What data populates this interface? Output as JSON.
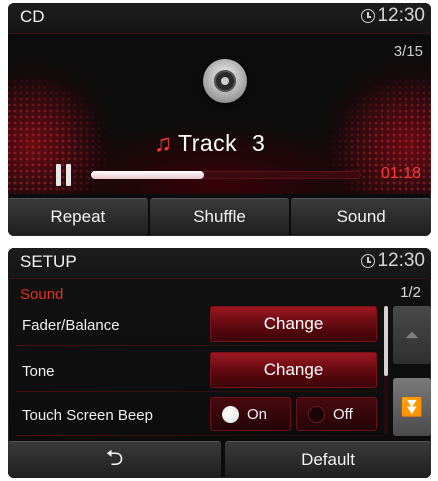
{
  "cd": {
    "title": "CD",
    "clock": "12:30",
    "track_count": "3/15",
    "track_title": "Track  3",
    "elapsed": "01:18",
    "progress": 0.42,
    "buttons": {
      "repeat": "Repeat",
      "shuffle": "Shuffle",
      "sound": "Sound"
    }
  },
  "setup": {
    "title": "SETUP",
    "clock": "12:30",
    "section": "Sound",
    "page": "1/2",
    "rows": [
      {
        "label": "Fader/Balance",
        "action": "Change"
      },
      {
        "label": "Tone",
        "action": "Change"
      },
      {
        "label": "Touch Screen Beep",
        "on": "On",
        "off": "Off",
        "selected": "On"
      }
    ],
    "buttons": {
      "default": "Default"
    }
  },
  "icons": [
    "clock-icon",
    "disc-icon",
    "music-note-icon",
    "pause-icon",
    "scroll-up-icon",
    "scroll-down-icon",
    "back-arrow-icon"
  ],
  "colors": {
    "accent": "#e0301f",
    "time_red": "#ff3a3a"
  }
}
